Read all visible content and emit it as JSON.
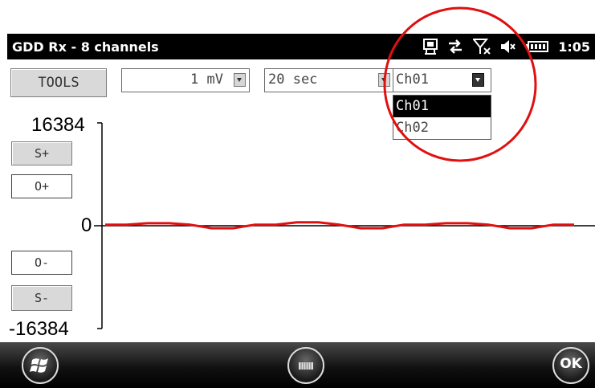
{
  "window": {
    "title": "GDD Rx - 8 channels",
    "time": "1:05"
  },
  "toolbar": {
    "tools_label": "TOOLS",
    "sensitivity": {
      "value": "1 mV"
    },
    "duration": {
      "value": "20 sec"
    },
    "channel": {
      "value": "Ch01",
      "options": [
        "Ch01",
        "Ch02"
      ],
      "selected": "Ch01"
    }
  },
  "chart": {
    "y_max_label": "16384",
    "y_zero_label": "0",
    "y_min_label": "-16384",
    "trace_color": "#e01010"
  },
  "side_buttons": {
    "s_plus": "S+",
    "o_plus": "O+",
    "o_minus": "O-",
    "s_minus": "S-"
  },
  "taskbar": {
    "ok_label": "OK"
  },
  "chart_data": {
    "type": "line",
    "ylim": [
      -16384,
      16384
    ],
    "series": [
      {
        "values": [
          [
            0,
            160
          ],
          [
            1,
            160
          ],
          [
            2,
            400
          ],
          [
            3,
            400
          ],
          [
            4,
            160
          ],
          [
            5,
            -400
          ],
          [
            6,
            -400
          ],
          [
            7,
            160
          ],
          [
            8,
            160
          ],
          [
            9,
            550
          ],
          [
            10,
            550
          ],
          [
            11,
            160
          ],
          [
            12,
            -400
          ],
          [
            13,
            -400
          ],
          [
            14,
            160
          ],
          [
            15,
            160
          ],
          [
            16,
            400
          ],
          [
            17,
            400
          ],
          [
            18,
            160
          ],
          [
            19,
            -400
          ],
          [
            20,
            -400
          ],
          [
            21,
            160
          ],
          [
            22,
            160
          ]
        ]
      }
    ]
  }
}
